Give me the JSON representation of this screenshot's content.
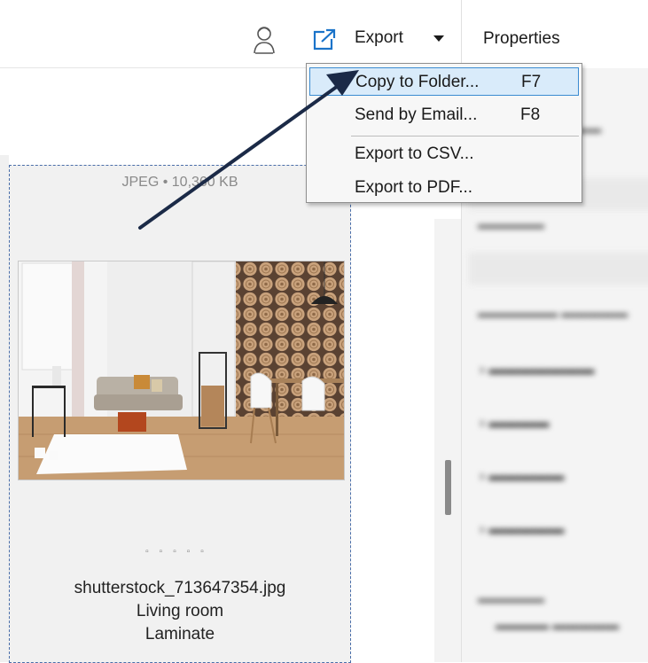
{
  "toolbar": {
    "export_label": "Export",
    "user_icon": "user-avatar-icon",
    "export_icon": "open-external-icon",
    "properties_label": "Properties"
  },
  "export_menu": {
    "items": [
      {
        "label": "Copy to Folder...",
        "shortcut": "F7",
        "selected": true
      },
      {
        "label": "Send by Email...",
        "shortcut": "F8",
        "selected": false
      },
      {
        "label": "Export to CSV...",
        "shortcut": "",
        "selected": false
      },
      {
        "label": "Export to PDF...",
        "shortcut": "",
        "selected": false
      }
    ]
  },
  "card": {
    "meta": "JPEG • 10,360 KB",
    "filename": "shutterstock_713647354.jpg",
    "line2": "Living room",
    "line3": "Laminate"
  },
  "colors": {
    "accent": "#3a8bd1",
    "selection_bg": "#d9ebfa",
    "arrow": "#1b2a47"
  }
}
